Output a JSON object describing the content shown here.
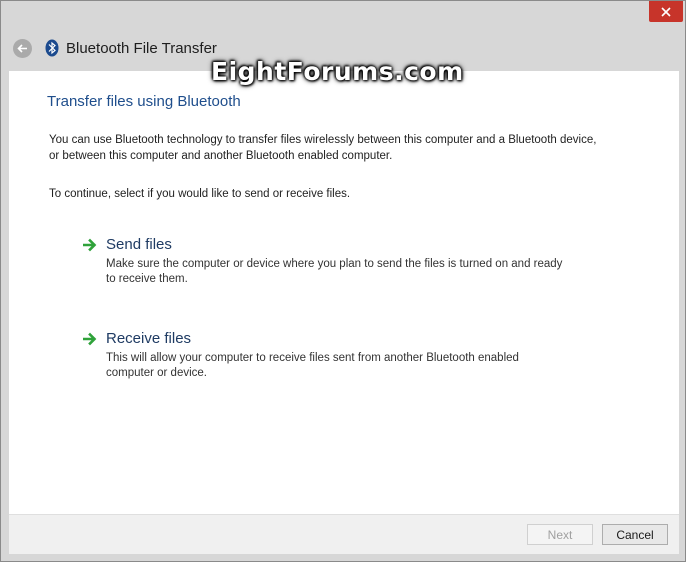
{
  "window": {
    "title": "Bluetooth File Transfer",
    "watermark": "EightForums.com"
  },
  "content": {
    "heading": "Transfer files using Bluetooth",
    "intro": "You can use Bluetooth technology to transfer files wirelessly between this computer and a Bluetooth device, or between this computer and another Bluetooth enabled computer.",
    "instruction": "To continue, select if you would like to send or receive files.",
    "options": [
      {
        "title": "Send files",
        "description": "Make sure the computer or device where you plan to send the files is turned on and ready to receive them."
      },
      {
        "title": "Receive files",
        "description": "This will allow your computer to receive files sent from another Bluetooth enabled computer or device."
      }
    ]
  },
  "footer": {
    "next_label": "Next",
    "cancel_label": "Cancel"
  },
  "colors": {
    "close_button": "#c7342a",
    "heading": "#1f4e8c",
    "arrow": "#2fa23a"
  },
  "icons": {
    "back": "back-arrow-icon",
    "bluetooth": "bluetooth-icon",
    "close": "close-icon",
    "option": "green-arrow-icon"
  }
}
